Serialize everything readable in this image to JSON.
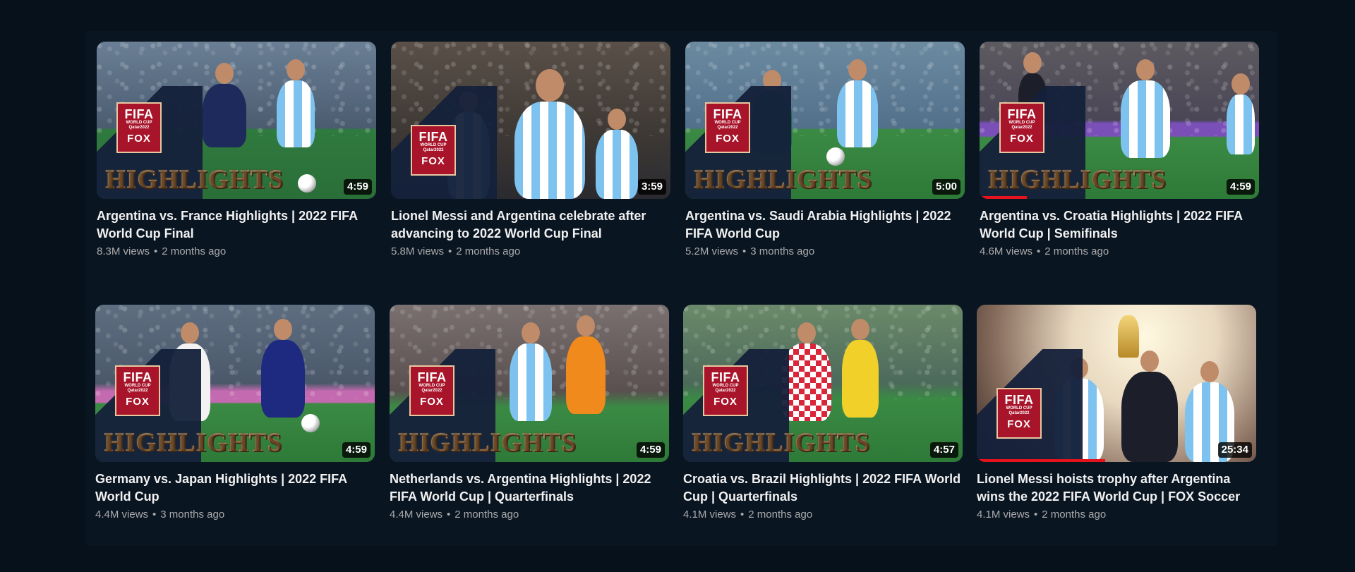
{
  "overlay": {
    "fifa": "FIFA",
    "world_cup": "WORLD CUP",
    "qatar": "Qatar2022",
    "fox": "FOX",
    "highlights": "HIGHLIGHTS"
  },
  "videos": [
    {
      "title": "Argentina vs. France Highlights | 2022 FIFA World Cup Final",
      "views": "8.3M views",
      "age": "2 months ago",
      "duration": "4:59",
      "watched_fraction": 0
    },
    {
      "title": "Lionel Messi and Argentina celebrate after advancing to 2022 World Cup Final",
      "views": "5.8M views",
      "age": "2 months ago",
      "duration": "3:59",
      "watched_fraction": 0
    },
    {
      "title": "Argentina vs. Saudi Arabia Highlights | 2022 FIFA World Cup",
      "views": "5.2M views",
      "age": "3 months ago",
      "duration": "5:00",
      "watched_fraction": 0
    },
    {
      "title": "Argentina vs. Croatia Highlights | 2022 FIFA World Cup | Semifinals",
      "views": "4.6M views",
      "age": "2 months ago",
      "duration": "4:59",
      "watched_fraction": 0.17
    },
    {
      "title": "Germany vs. Japan Highlights | 2022 FIFA World Cup",
      "views": "4.4M views",
      "age": "3 months ago",
      "duration": "4:59",
      "watched_fraction": 0
    },
    {
      "title": "Netherlands vs. Argentina Highlights | 2022 FIFA World Cup | Quarterfinals",
      "views": "4.4M views",
      "age": "2 months ago",
      "duration": "4:59",
      "watched_fraction": 0
    },
    {
      "title": "Croatia vs. Brazil Highlights | 2022 FIFA World Cup | Quarterfinals",
      "views": "4.1M views",
      "age": "2 months ago",
      "duration": "4:57",
      "watched_fraction": 0
    },
    {
      "title": "Lionel Messi hoists trophy after Argentina wins the 2022 FIFA World Cup | FOX Soccer",
      "views": "4.1M views",
      "age": "2 months ago",
      "duration": "25:34",
      "watched_fraction": 0.46
    }
  ],
  "colors": {
    "page_background": "#07111c",
    "title_text": "#f1f1f1",
    "meta_text": "#aaaaaa",
    "progress_red": "#e5131b",
    "badge_red": "#a8142a",
    "highlights_gold": "#f1d2a5"
  }
}
